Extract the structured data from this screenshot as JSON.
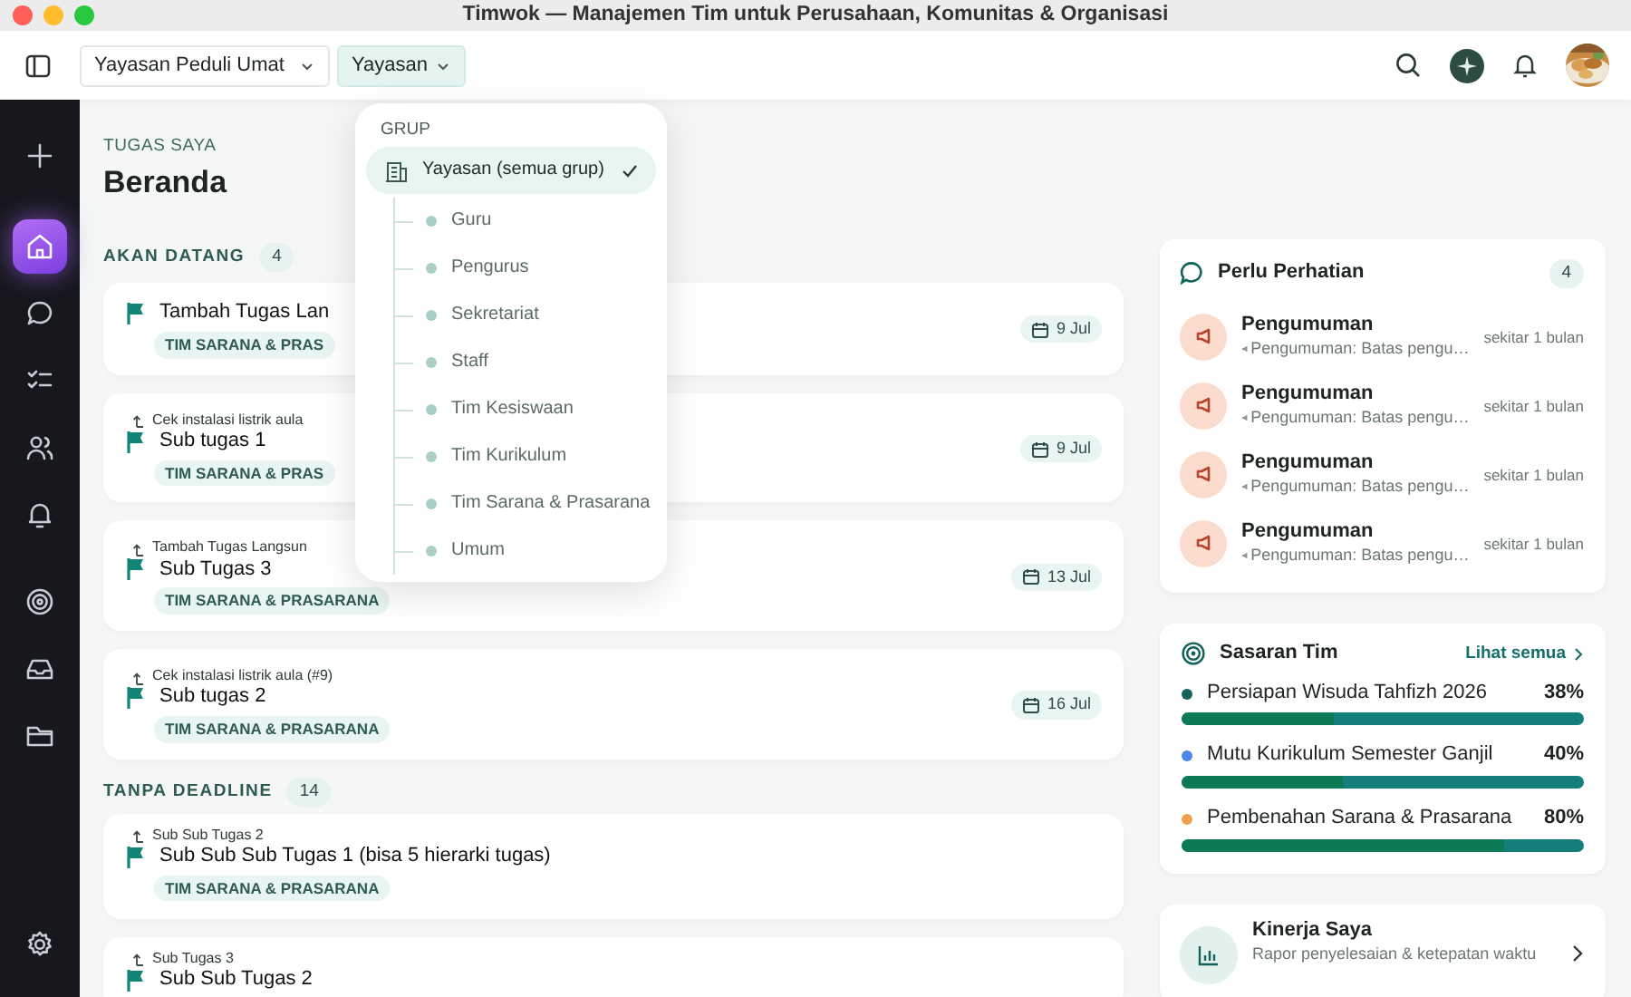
{
  "window": {
    "title": "Timwok — Manajemen Tim untuk Perusahaan, Komunitas & Organisasi"
  },
  "toolbar": {
    "organization_select": "Yayasan Peduli Umat",
    "group_select": {
      "label": "Yayasan",
      "expanded": true
    }
  },
  "sidebar": {
    "items": [
      {
        "kind": "add",
        "selected": false
      },
      {
        "kind": "home",
        "selected": true
      },
      {
        "kind": "chat",
        "selected": false
      },
      {
        "kind": "checklist",
        "selected": false
      },
      {
        "kind": "people",
        "selected": false
      },
      {
        "kind": "bell",
        "selected": false
      },
      {
        "kind": "target",
        "selected": false
      },
      {
        "kind": "inbox",
        "selected": false
      },
      {
        "kind": "folder",
        "selected": false
      },
      {
        "kind": "settings",
        "selected": false
      }
    ]
  },
  "group_menu": {
    "header": "GRUP",
    "items": [
      {
        "label": "Yayasan (semua grup)",
        "selected": true,
        "children": [
          {
            "label": "Guru",
            "selected": false
          },
          {
            "label": "Pengurus",
            "selected": false
          },
          {
            "label": "Sekretariat",
            "selected": false
          },
          {
            "label": "Staff",
            "selected": false
          },
          {
            "label": "Tim Kesiswaan",
            "selected": false
          },
          {
            "label": "Tim Kurikulum",
            "selected": false
          },
          {
            "label": "Tim Sarana & Prasarana",
            "selected": false
          },
          {
            "label": "Umum",
            "selected": false
          }
        ]
      }
    ]
  },
  "tasks": {
    "heading": "TUGAS SAYA",
    "title": "Beranda",
    "sections": [
      {
        "title": "AKAN DATANG",
        "count": "4",
        "items": [
          {
            "title": "Tambah Tugas Lan",
            "tag": "TIM SARANA & PRAS",
            "date": "9 Jul"
          },
          {
            "parent": "Cek instalasi listrik aula",
            "title": "Sub tugas 1",
            "tag": "TIM SARANA & PRAS",
            "date": "9 Jul"
          },
          {
            "parent": "Tambah Tugas Langsun",
            "title": "Sub Tugas 3",
            "tag": "TIM SARANA & PRASARANA",
            "date": "13 Jul"
          },
          {
            "parent": "Cek instalasi listrik aula (#9)",
            "title": "Sub tugas 2",
            "tag": "TIM SARANA & PRASARANA",
            "date": "16 Jul"
          }
        ]
      },
      {
        "title": "TANPA DEADLINE",
        "count": "14",
        "items": [
          {
            "parent": "Sub Sub Tugas 2",
            "title": "Sub Sub Sub Tugas 1 (bisa 5 hierarki tugas)",
            "tag": "TIM SARANA & PRASARANA"
          },
          {
            "parent": "Sub Tugas 3",
            "title": "Sub Sub Tugas 2"
          }
        ]
      }
    ]
  },
  "attention": {
    "title": "Perlu Perhatian",
    "count": "4",
    "items": [
      {
        "title": "Pengumuman",
        "preview": "Pengumuman: Batas pengu…",
        "time": "sekitar 1 bulan"
      },
      {
        "title": "Pengumuman",
        "preview": "Pengumuman: Batas pengu…",
        "time": "sekitar 1 bulan"
      },
      {
        "title": "Pengumuman",
        "preview": "Pengumuman: Batas pengu…",
        "time": "sekitar 1 bulan"
      },
      {
        "title": "Pengumuman",
        "preview": "Pengumuman: Batas pengu…",
        "time": "sekitar 1 bulan"
      }
    ]
  },
  "goals": {
    "title": "Sasaran Tim",
    "link": "Lihat semua",
    "items": [
      {
        "name": "Persiapan Wisuda Tahfizh 2026",
        "percent": "38%",
        "level": 0.38,
        "color": "#13635c"
      },
      {
        "name": "Mutu Kurikulum Semester Ganjil",
        "percent": "40%",
        "level": 0.4,
        "color": "#4a86ec"
      },
      {
        "name": "Pembenahan Sarana & Prasarana",
        "percent": "80%",
        "level": 0.8,
        "color": "#eea04c"
      }
    ]
  },
  "performance": {
    "title": "Kinerja Saya",
    "subtitle": "Rapor penyelesaian & ketepatan waktu"
  }
}
